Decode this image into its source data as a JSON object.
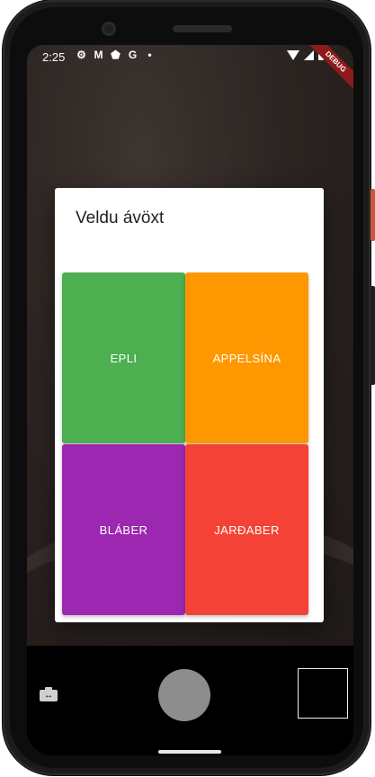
{
  "status_bar": {
    "time": "2:25",
    "icons": [
      "gear-icon",
      "gmail-icon",
      "shield-icon",
      "google-icon",
      "dot-icon"
    ],
    "right_icons": [
      "wifi-icon",
      "signal-icon",
      "battery-icon"
    ],
    "debug_banner": "DEBUG"
  },
  "dialog": {
    "title": "Veldu ávöxt",
    "options": [
      {
        "label": "EPLI",
        "color": "#4caf50"
      },
      {
        "label": "APPELSÍNA",
        "color": "#ff9800"
      },
      {
        "label": "BLÁBER",
        "color": "#9c27b0"
      },
      {
        "label": "JARÐABER",
        "color": "#f44336"
      }
    ]
  },
  "camera_controls": {
    "switch_icon": "switch-camera-icon",
    "shutter_color": "#8d8d8d"
  }
}
